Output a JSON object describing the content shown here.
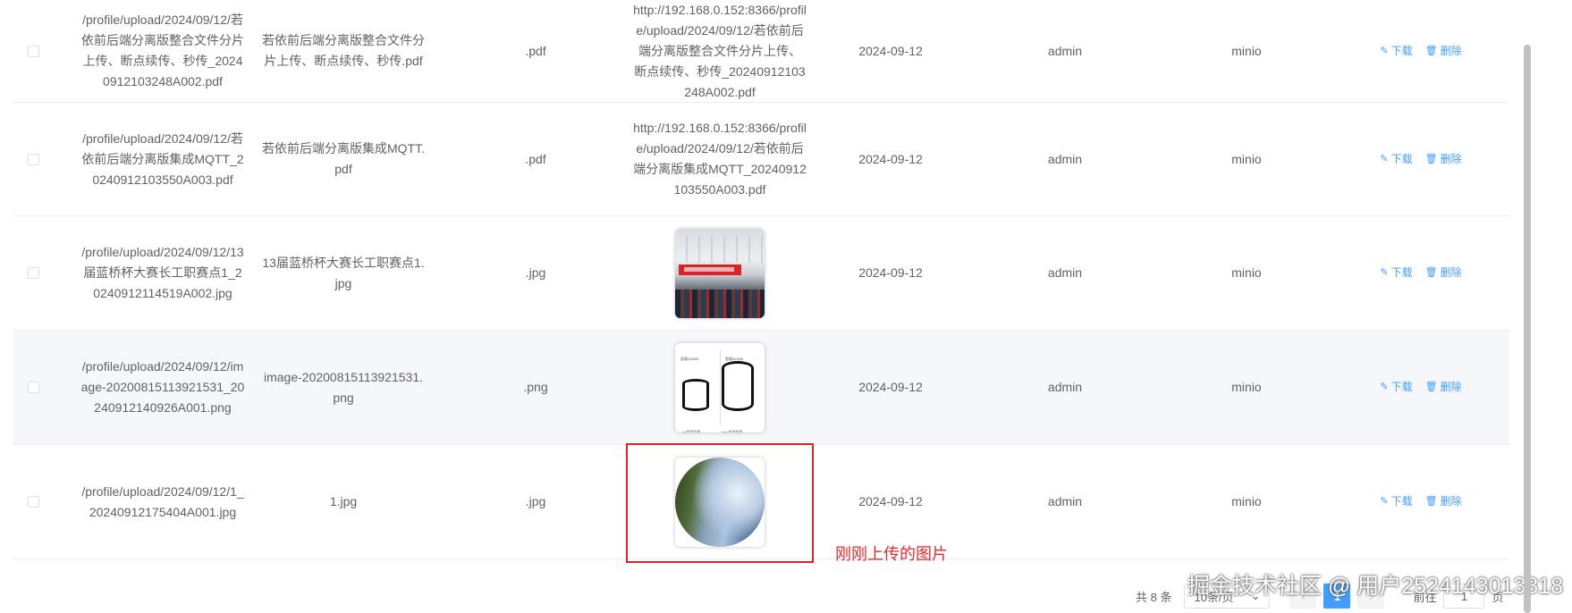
{
  "rows": [
    {
      "path": "/profile/upload/2024/09/12/若依前后端分离版整合文件分片上传、断点续传、秒传_20240912103248A002.pdf",
      "name": "若依前后端分离版整合文件分片上传、断点续传、秒传.pdf",
      "ext": ".pdf",
      "url": "http://192.168.0.152:8366/profile/upload/2024/09/12/若依前后端分离版整合文件分片上传、断点续传、秒传_20240912103248A002.pdf",
      "date": "2024-09-12",
      "user": "admin",
      "storage": "minio"
    },
    {
      "path": "/profile/upload/2024/09/12/若依前后端分离版集成MQTT_20240912103550A003.pdf",
      "name": "若依前后端分离版集成MQTT.pdf",
      "ext": ".pdf",
      "url": "http://192.168.0.152:8366/profile/upload/2024/09/12/若依前后端分离版集成MQTT_20240912103550A003.pdf",
      "date": "2024-09-12",
      "user": "admin",
      "storage": "minio"
    },
    {
      "path": "/profile/upload/2024/09/12/13届蓝桥杯大赛长工职赛点1_20240912114519A002.jpg",
      "name": "13届蓝桥杯大赛长工职赛点1.jpg",
      "ext": ".jpg",
      "date": "2024-09-12",
      "user": "admin",
      "storage": "minio"
    },
    {
      "path": "/profile/upload/2024/09/12/image-20200815113921531_20240912140926A001.png",
      "name": "image-20200815113921531.png",
      "ext": ".png",
      "date": "2024-09-12",
      "user": "admin",
      "storage": "minio"
    },
    {
      "path": "/profile/upload/2024/09/12/1_20240912175404A001.jpg",
      "name": "1.jpg",
      "ext": ".jpg",
      "date": "2024-09-12",
      "user": "admin",
      "storage": "minio"
    }
  ],
  "actions": {
    "download_label": "下载",
    "delete_label": "删除",
    "download_icon": "edit-icon",
    "delete_icon": "trash-icon"
  },
  "diagram": {
    "left_top": "容量200KB",
    "right_top": "容量520KB",
    "left_bottom": "int类型容量",
    "right_bottom": "long类型容量"
  },
  "annotation": {
    "text": "刚刚上传的图片",
    "color": "#d9262b"
  },
  "pagination": {
    "total": "共 8 条",
    "page_size": "10条/页",
    "current_page": "1",
    "goto_prefix": "前往",
    "goto_value": "1",
    "goto_suffix": "页"
  },
  "watermark": "掘金技术社区 @ 用户2524143013818",
  "colors": {
    "link": "#409eff",
    "annotation_red": "#d9262b",
    "row_hover": "#f5f7fa"
  }
}
